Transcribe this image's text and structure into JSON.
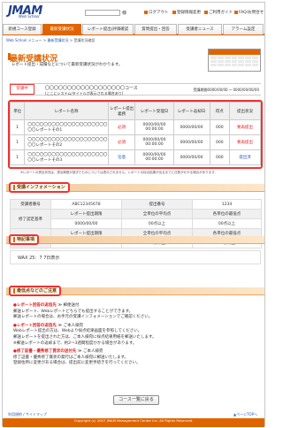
{
  "header": {
    "logo": "JMAM",
    "logo_sub": "Web School",
    "user_suffix": "様",
    "links": [
      "ログアウト",
      "登録情報変更",
      "ご利用ガイド",
      "FAQ/お問合せ"
    ]
  },
  "nav": {
    "tabs": [
      "新規コース登録",
      "最新受講状況",
      "レポート提出/評価確認",
      "質問提出・回答",
      "受講者ニュース",
      "アラーム設定"
    ],
    "active_index": 1
  },
  "breadcrumb": {
    "items": [
      "Web School メニュー",
      "最新受講状況",
      "受講状況確認"
    ],
    "sep": " > "
  },
  "page": {
    "title": "最新受講状況",
    "subtitle": "レポート提出・成績などについて最新受講状況がわかります。"
  },
  "course": {
    "button": "受講中",
    "name": "〇〇〇〇〇〇〇〇〇〇〇〇〇〇〇〇〇〇コース",
    "sub": "(ここにシステム/タイトルが表示される場合あり)",
    "period": "受講期間0000/00/00 ~ 0000/00/00/00"
  },
  "report_table": {
    "headers": [
      "単位",
      "レポート名称",
      "レポート提出義務",
      "レポート受理日",
      "レポート返却日",
      "得点",
      "提出状況"
    ],
    "rows": [
      {
        "unit": "1",
        "name": "〇〇〇〇〇〇〇〇〇〇〇〇〇〇〇〇〇〇〇〇〇〇レポートその1",
        "required": "必須",
        "received": "0000/00/00 00:00:00",
        "returned": "0000/00/00",
        "score": "000",
        "status": "要再提出"
      },
      {
        "unit": "1",
        "name": "〇〇〇〇〇〇〇〇〇〇〇〇〇〇〇〇〇〇〇〇〇〇レポートその2",
        "required": "必須",
        "received": "0000/00/00 00:00:00",
        "returned": "0000/00/00",
        "score": "000",
        "status": "要再提出"
      },
      {
        "unit": "1",
        "name": "〇〇〇〇〇〇〇〇〇〇〇〇〇〇〇〇〇〇〇〇〇〇レポートその3",
        "required": "任意",
        "received": "0000/00/00 00:00:00",
        "returned": "0000/00/00",
        "score": "000",
        "status": "提出済"
      }
    ],
    "note": "※レポートの提出状況は、提出期限が過ぎたものについては表示されません。レポートの採点結果が出るまでに日数がかかる場合があります。"
  },
  "info": {
    "title": "受講インフォメーション",
    "rows": [
      {
        "label": "受講者番号",
        "value": "ABC12345678",
        "label2": "提出番号",
        "value2": "1234"
      },
      {
        "label": "修了認定基準",
        "cells": [
          "レポート提出期限",
          "全単位の平均点",
          "各単位の最低点"
        ],
        "vals": [
          "0000/00/00",
          "00点以上",
          "00点以上"
        ]
      },
      {
        "label": "優秀修了認定基準",
        "cells": [
          "レポート提出期限",
          "全単位の平均点",
          "各単位の最低点"
        ],
        "vals": [
          "0000/00/00",
          "00点以上",
          "00点以上"
        ]
      }
    ]
  },
  "special": {
    "title": "特記事項",
    "text": "WAX 25：7 7日表示"
  },
  "caution": {
    "title": "最低点などのご注意",
    "items": [
      {
        "head": "●レポート回答の返信先",
        "mark": "≫ 郵便送付",
        "lines": [
          "郵送レポート、Webレポートどちらでも提出することができます。",
          "郵送レポートの場合は、お手元の受講インフォメーションでご確認ください。"
        ]
      },
      {
        "head": "●レポート回答の返信先",
        "mark": "≫ ご本人様宛",
        "lines": [
          "Webレポート提出の方は、Webより採点結果画面を参照してください。",
          "郵送レポートを提出された方は、ご本人様宛に採点結果用紙を郵送いたします。",
          "※郵送レポートの返却まで、約2～3週間程度かかる場合があります。"
        ]
      },
      {
        "head": "●修了証書・優秀修了賞状の送付先",
        "mark": "≫ ご本人様宛",
        "lines": [
          "修了証書・優秀修了賞状の発行はご本人様宛に郵送いたします。",
          "登録住所に変更がある場合は、提出前に変更手続きを行ってください。"
        ]
      }
    ]
  },
  "back_button": "コース一覧に戻る",
  "footer": {
    "links": "利用規約 / サイトマップ",
    "pagetop": "▲ページTOPへ",
    "copyright": "Copyright (c) 2007 JMAM Management Center Inc. All Rights Reserved."
  }
}
